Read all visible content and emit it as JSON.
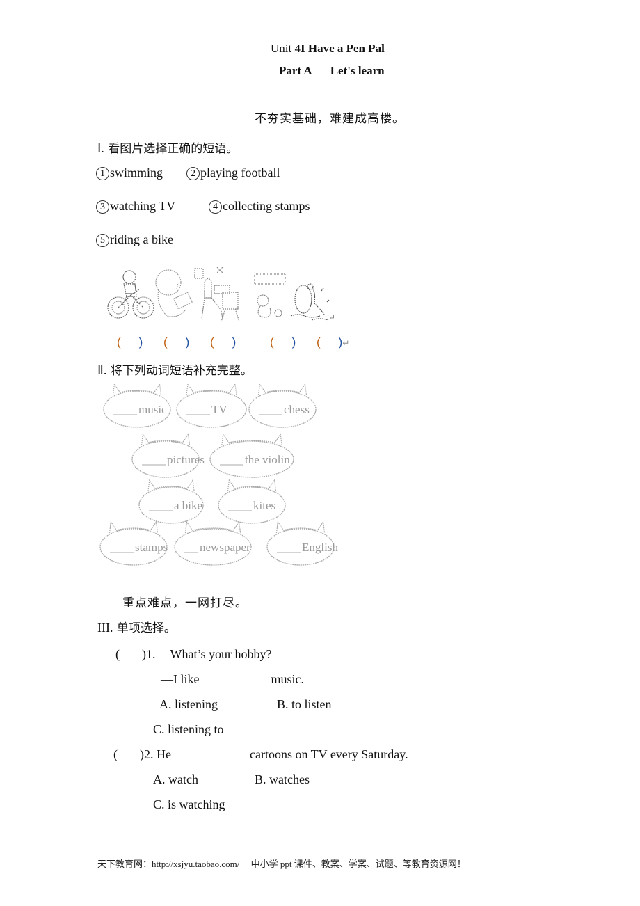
{
  "header": {
    "unit_prefix": "Unit 4",
    "unit_title": "I Have a Pen Pal",
    "part": "Part A",
    "subtitle": "Let's learn"
  },
  "motto_1": "不夯实基础，难建成高楼。",
  "section1": {
    "number": "Ⅰ.",
    "instruction": "看图片选择正确的短语。",
    "options": [
      {
        "marker": "1",
        "text": "swimming"
      },
      {
        "marker": "2",
        "text": "playing football"
      },
      {
        "marker": "3",
        "text": "watching TV"
      },
      {
        "marker": "4",
        "text": "collecting stamps"
      },
      {
        "marker": "5",
        "text": "riding a bike"
      }
    ],
    "pictures": [
      "riding-bike-illustration",
      "collecting-stamps-illustration",
      "watching-tv-illustration",
      "playing-football-illustration",
      "swimming-illustration"
    ],
    "answer_parens": [
      "(　　)",
      "(　　)",
      "(　　)",
      "(　　)",
      "(　　)"
    ],
    "return_mark": "↵"
  },
  "section2": {
    "number": "Ⅱ.",
    "instruction": "将下列动词短语补充完整。",
    "bubbles": [
      {
        "blank": "____",
        "text": "music"
      },
      {
        "blank": "____",
        "text": "TV"
      },
      {
        "blank": "____",
        "text": "chess"
      },
      {
        "blank": "____",
        "text": "pictures"
      },
      {
        "blank": "____",
        "text": "the violin"
      },
      {
        "blank": "____",
        "text": "a bike"
      },
      {
        "blank": "____",
        "text": "kites"
      },
      {
        "blank": "____",
        "text": "stamps"
      },
      {
        "blank": "__",
        "text": "newspaper"
      },
      {
        "blank": "____",
        "text": "English"
      }
    ]
  },
  "motto_2": "重点难点，一网打尽。",
  "section3": {
    "number": "III.",
    "instruction": "单项选择。",
    "questions": [
      {
        "paren": "(        )",
        "number": "1.",
        "line1": "—What’s your hobby?",
        "line2_prefix": "—I like",
        "line2_suffix": "music.",
        "options": {
          "A": "A. listening",
          "B": "B. to listen",
          "C": "C. listening to"
        }
      },
      {
        "paren": "(        )",
        "number": "2.",
        "line1_prefix": "He",
        "line1_suffix": "cartoons on TV every Saturday.",
        "options": {
          "A": "A. watch",
          "B": "B. watches",
          "C": "C. is watching"
        }
      }
    ]
  },
  "footer": "天下教育网：http://xsjyu.taobao.com/　 中小学 ppt 课件、教案、学案、试题、等教育资源网！"
}
